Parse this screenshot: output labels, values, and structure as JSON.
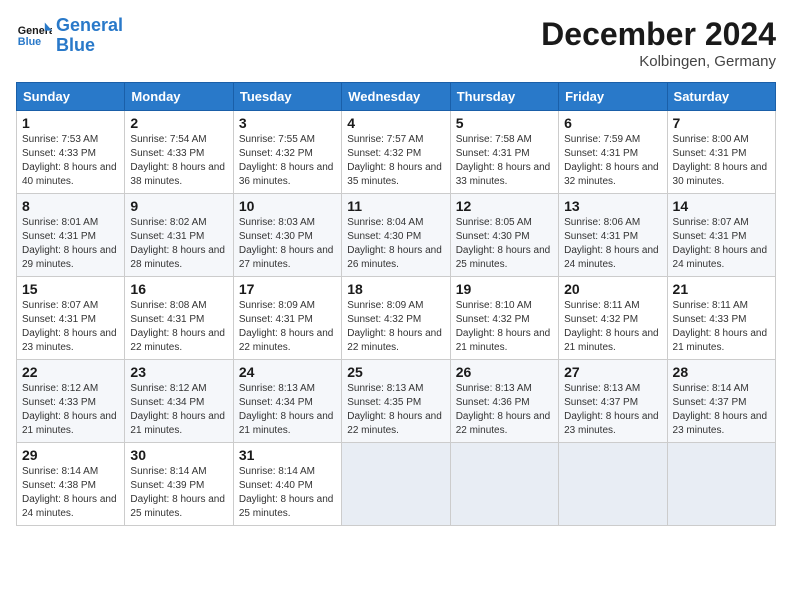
{
  "header": {
    "logo_line1": "General",
    "logo_line2": "Blue",
    "month": "December 2024",
    "location": "Kolbingen, Germany"
  },
  "days_of_week": [
    "Sunday",
    "Monday",
    "Tuesday",
    "Wednesday",
    "Thursday",
    "Friday",
    "Saturday"
  ],
  "weeks": [
    [
      {
        "day": "1",
        "sunrise": "Sunrise: 7:53 AM",
        "sunset": "Sunset: 4:33 PM",
        "daylight": "Daylight: 8 hours and 40 minutes."
      },
      {
        "day": "2",
        "sunrise": "Sunrise: 7:54 AM",
        "sunset": "Sunset: 4:33 PM",
        "daylight": "Daylight: 8 hours and 38 minutes."
      },
      {
        "day": "3",
        "sunrise": "Sunrise: 7:55 AM",
        "sunset": "Sunset: 4:32 PM",
        "daylight": "Daylight: 8 hours and 36 minutes."
      },
      {
        "day": "4",
        "sunrise": "Sunrise: 7:57 AM",
        "sunset": "Sunset: 4:32 PM",
        "daylight": "Daylight: 8 hours and 35 minutes."
      },
      {
        "day": "5",
        "sunrise": "Sunrise: 7:58 AM",
        "sunset": "Sunset: 4:31 PM",
        "daylight": "Daylight: 8 hours and 33 minutes."
      },
      {
        "day": "6",
        "sunrise": "Sunrise: 7:59 AM",
        "sunset": "Sunset: 4:31 PM",
        "daylight": "Daylight: 8 hours and 32 minutes."
      },
      {
        "day": "7",
        "sunrise": "Sunrise: 8:00 AM",
        "sunset": "Sunset: 4:31 PM",
        "daylight": "Daylight: 8 hours and 30 minutes."
      }
    ],
    [
      {
        "day": "8",
        "sunrise": "Sunrise: 8:01 AM",
        "sunset": "Sunset: 4:31 PM",
        "daylight": "Daylight: 8 hours and 29 minutes."
      },
      {
        "day": "9",
        "sunrise": "Sunrise: 8:02 AM",
        "sunset": "Sunset: 4:31 PM",
        "daylight": "Daylight: 8 hours and 28 minutes."
      },
      {
        "day": "10",
        "sunrise": "Sunrise: 8:03 AM",
        "sunset": "Sunset: 4:30 PM",
        "daylight": "Daylight: 8 hours and 27 minutes."
      },
      {
        "day": "11",
        "sunrise": "Sunrise: 8:04 AM",
        "sunset": "Sunset: 4:30 PM",
        "daylight": "Daylight: 8 hours and 26 minutes."
      },
      {
        "day": "12",
        "sunrise": "Sunrise: 8:05 AM",
        "sunset": "Sunset: 4:30 PM",
        "daylight": "Daylight: 8 hours and 25 minutes."
      },
      {
        "day": "13",
        "sunrise": "Sunrise: 8:06 AM",
        "sunset": "Sunset: 4:31 PM",
        "daylight": "Daylight: 8 hours and 24 minutes."
      },
      {
        "day": "14",
        "sunrise": "Sunrise: 8:07 AM",
        "sunset": "Sunset: 4:31 PM",
        "daylight": "Daylight: 8 hours and 24 minutes."
      }
    ],
    [
      {
        "day": "15",
        "sunrise": "Sunrise: 8:07 AM",
        "sunset": "Sunset: 4:31 PM",
        "daylight": "Daylight: 8 hours and 23 minutes."
      },
      {
        "day": "16",
        "sunrise": "Sunrise: 8:08 AM",
        "sunset": "Sunset: 4:31 PM",
        "daylight": "Daylight: 8 hours and 22 minutes."
      },
      {
        "day": "17",
        "sunrise": "Sunrise: 8:09 AM",
        "sunset": "Sunset: 4:31 PM",
        "daylight": "Daylight: 8 hours and 22 minutes."
      },
      {
        "day": "18",
        "sunrise": "Sunrise: 8:09 AM",
        "sunset": "Sunset: 4:32 PM",
        "daylight": "Daylight: 8 hours and 22 minutes."
      },
      {
        "day": "19",
        "sunrise": "Sunrise: 8:10 AM",
        "sunset": "Sunset: 4:32 PM",
        "daylight": "Daylight: 8 hours and 21 minutes."
      },
      {
        "day": "20",
        "sunrise": "Sunrise: 8:11 AM",
        "sunset": "Sunset: 4:32 PM",
        "daylight": "Daylight: 8 hours and 21 minutes."
      },
      {
        "day": "21",
        "sunrise": "Sunrise: 8:11 AM",
        "sunset": "Sunset: 4:33 PM",
        "daylight": "Daylight: 8 hours and 21 minutes."
      }
    ],
    [
      {
        "day": "22",
        "sunrise": "Sunrise: 8:12 AM",
        "sunset": "Sunset: 4:33 PM",
        "daylight": "Daylight: 8 hours and 21 minutes."
      },
      {
        "day": "23",
        "sunrise": "Sunrise: 8:12 AM",
        "sunset": "Sunset: 4:34 PM",
        "daylight": "Daylight: 8 hours and 21 minutes."
      },
      {
        "day": "24",
        "sunrise": "Sunrise: 8:13 AM",
        "sunset": "Sunset: 4:34 PM",
        "daylight": "Daylight: 8 hours and 21 minutes."
      },
      {
        "day": "25",
        "sunrise": "Sunrise: 8:13 AM",
        "sunset": "Sunset: 4:35 PM",
        "daylight": "Daylight: 8 hours and 22 minutes."
      },
      {
        "day": "26",
        "sunrise": "Sunrise: 8:13 AM",
        "sunset": "Sunset: 4:36 PM",
        "daylight": "Daylight: 8 hours and 22 minutes."
      },
      {
        "day": "27",
        "sunrise": "Sunrise: 8:13 AM",
        "sunset": "Sunset: 4:37 PM",
        "daylight": "Daylight: 8 hours and 23 minutes."
      },
      {
        "day": "28",
        "sunrise": "Sunrise: 8:14 AM",
        "sunset": "Sunset: 4:37 PM",
        "daylight": "Daylight: 8 hours and 23 minutes."
      }
    ],
    [
      {
        "day": "29",
        "sunrise": "Sunrise: 8:14 AM",
        "sunset": "Sunset: 4:38 PM",
        "daylight": "Daylight: 8 hours and 24 minutes."
      },
      {
        "day": "30",
        "sunrise": "Sunrise: 8:14 AM",
        "sunset": "Sunset: 4:39 PM",
        "daylight": "Daylight: 8 hours and 25 minutes."
      },
      {
        "day": "31",
        "sunrise": "Sunrise: 8:14 AM",
        "sunset": "Sunset: 4:40 PM",
        "daylight": "Daylight: 8 hours and 25 minutes."
      },
      null,
      null,
      null,
      null
    ]
  ]
}
